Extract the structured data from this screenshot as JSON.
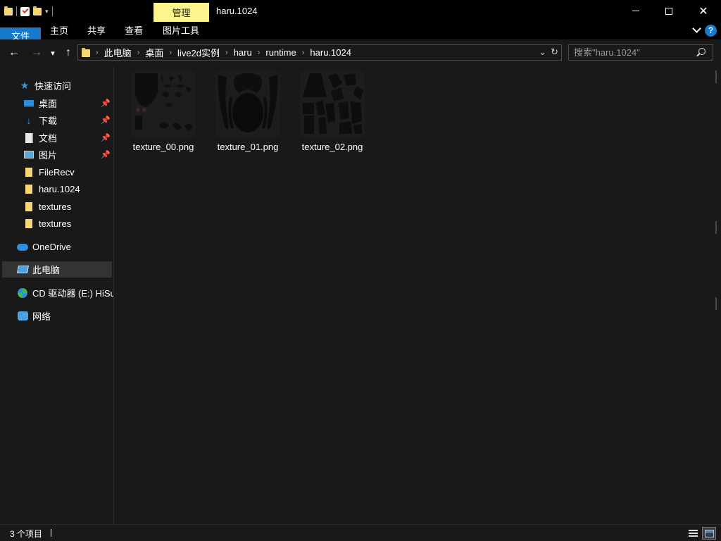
{
  "window": {
    "title": "haru.1024",
    "manage_tab": "管理"
  },
  "ribbon": {
    "tabs": [
      "文件",
      "主页",
      "共享",
      "查看",
      "图片工具"
    ],
    "help": "?"
  },
  "address": {
    "crumbs": [
      "此电脑",
      "桌面",
      "live2d实例",
      "haru",
      "runtime",
      "haru.1024"
    ],
    "search_placeholder": "搜索\"haru.1024\""
  },
  "sidebar": {
    "quick_access": "快速访问",
    "items": [
      {
        "label": "桌面",
        "icon": "desktop-icon",
        "pinned": true
      },
      {
        "label": "下载",
        "icon": "download-icon",
        "pinned": true
      },
      {
        "label": "文档",
        "icon": "document-icon",
        "pinned": true
      },
      {
        "label": "图片",
        "icon": "pictures-icon",
        "pinned": true
      },
      {
        "label": "FileRecv",
        "icon": "folder-icon",
        "pinned": false
      },
      {
        "label": "haru.1024",
        "icon": "folder-icon",
        "pinned": false
      },
      {
        "label": "textures",
        "icon": "folder-icon",
        "pinned": false
      },
      {
        "label": "textures",
        "icon": "folder-icon",
        "pinned": false
      }
    ],
    "onedrive": "OneDrive",
    "this_pc": "此电脑",
    "cd_drive": "CD 驱动器 (E:) HiSuite",
    "network": "网络"
  },
  "files": [
    {
      "name": "texture_00.png"
    },
    {
      "name": "texture_01.png"
    },
    {
      "name": "texture_02.png"
    }
  ],
  "status": {
    "count": "3 个项目"
  },
  "colors": {
    "accent": "#1979ca",
    "manage_tab": "#fcf58d",
    "background": "#191919",
    "folder": "#f8d775"
  }
}
